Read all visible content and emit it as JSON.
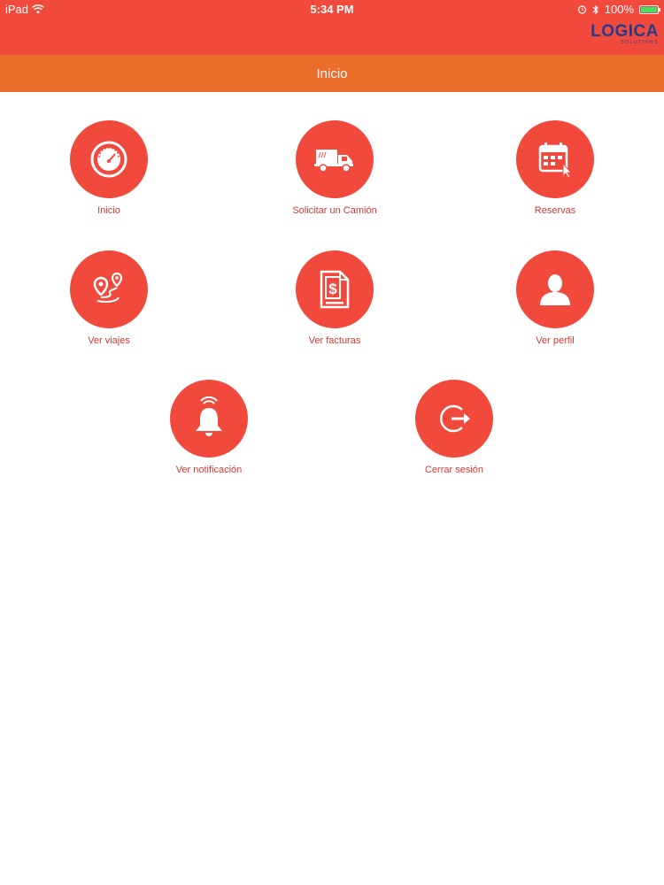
{
  "status_bar": {
    "device": "iPad",
    "time": "5:34 PM",
    "battery": "100%"
  },
  "brand": {
    "name": "LOGICA",
    "tagline": "SOLUTIONS"
  },
  "header": {
    "title": "Inicio"
  },
  "menu": {
    "items": [
      {
        "label": "Inicio",
        "icon": "speedometer-icon"
      },
      {
        "label": "Solicitar un Camión",
        "icon": "truck-icon"
      },
      {
        "label": "Reservas",
        "icon": "calendar-icon"
      },
      {
        "label": "Ver viajes",
        "icon": "route-pin-icon"
      },
      {
        "label": "Ver facturas",
        "icon": "invoice-icon"
      },
      {
        "label": "Ver perfil",
        "icon": "user-icon"
      },
      {
        "label": "Ver notificación",
        "icon": "bell-icon"
      },
      {
        "label": "Cerrar sesión",
        "icon": "logout-icon"
      }
    ]
  },
  "colors": {
    "primary": "#f2493d",
    "title_bar": "#ec6e2b",
    "label": "#cf3b31",
    "brand": "#233d8c"
  }
}
